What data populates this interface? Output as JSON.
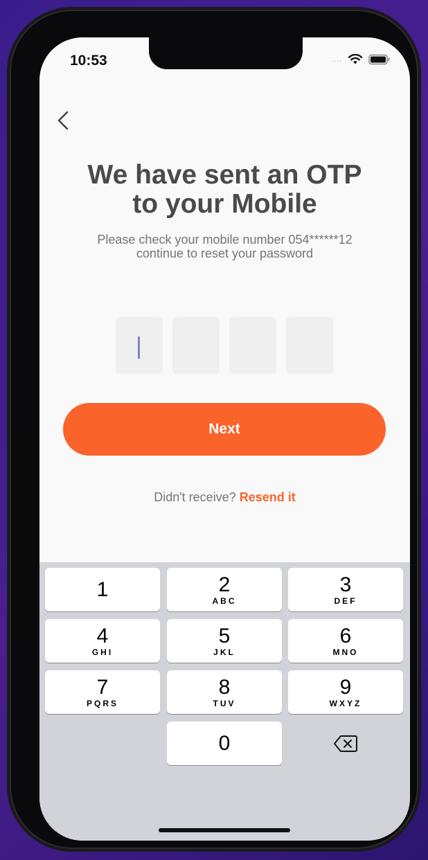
{
  "status_bar": {
    "time": "10:53",
    "signal_dots": "....",
    "wifi_icon": "wifi-icon",
    "battery_icon": "battery-icon"
  },
  "header": {
    "back_icon": "chevron-left-icon",
    "title_line1": "We have sent an OTP",
    "title_line2": "to your Mobile",
    "subtitle_line1": "Please check your mobile number 054******12",
    "subtitle_line2": "continue to reset your password"
  },
  "otp": {
    "boxes": [
      "",
      "",
      "",
      ""
    ],
    "active_index": 0
  },
  "next_button": {
    "label": "Next",
    "color": "#fa632a"
  },
  "resend": {
    "prompt": "Didn't receive?",
    "link": "Resend it"
  },
  "keyboard": {
    "keys": [
      {
        "num": "1",
        "letters": ""
      },
      {
        "num": "2",
        "letters": "ABC"
      },
      {
        "num": "3",
        "letters": "DEF"
      },
      {
        "num": "4",
        "letters": "GHI"
      },
      {
        "num": "5",
        "letters": "JKL"
      },
      {
        "num": "6",
        "letters": "MNO"
      },
      {
        "num": "7",
        "letters": "PQRS"
      },
      {
        "num": "8",
        "letters": "TUV"
      },
      {
        "num": "9",
        "letters": "WXYZ"
      },
      {
        "num": "0",
        "letters": ""
      }
    ],
    "delete_icon": "backspace-icon"
  }
}
